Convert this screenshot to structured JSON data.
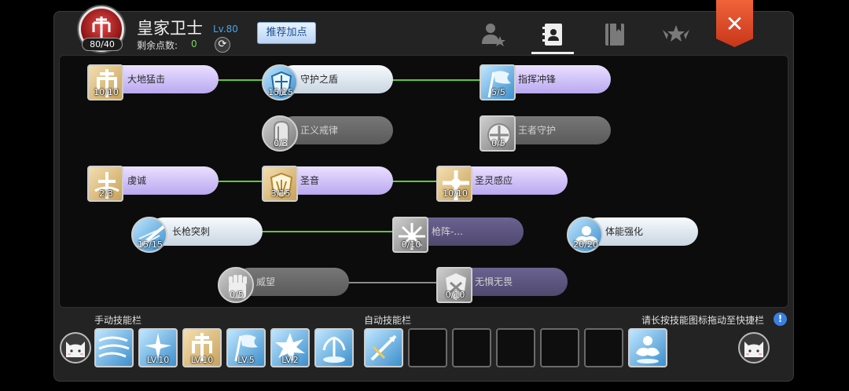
{
  "header": {
    "class_name": "皇家卫士",
    "level": "Lv.80",
    "level_badge": "80/40",
    "points_label": "剩余点数:",
    "points_value": "0",
    "recommend_label": "推荐加点",
    "close_label": "✕"
  },
  "tabs": [
    {
      "name": "character-tab",
      "icon": "person-star-icon",
      "active": false
    },
    {
      "name": "skill-book-tab",
      "icon": "contact-book-icon",
      "active": true
    },
    {
      "name": "book-tab",
      "icon": "book-icon",
      "active": false
    },
    {
      "name": "rank-tab",
      "icon": "winged-star-icon",
      "active": false
    }
  ],
  "skills": [
    {
      "name": "大地猛击",
      "count": "10/10",
      "style": "purple",
      "icon": "gold"
    },
    {
      "name": "守护之盾",
      "count": "15/15",
      "style": "light",
      "icon": "blue"
    },
    {
      "name": "指挥冲锋",
      "count": "5/5",
      "style": "purple",
      "icon": "blue"
    },
    {
      "name": "正义戒律",
      "count": "0/3",
      "style": "gray",
      "icon": "gray"
    },
    {
      "name": "王者守护",
      "count": "0/5",
      "style": "gray",
      "icon": "gray"
    },
    {
      "name": "虔诚",
      "count": "2/3",
      "style": "purple",
      "icon": "gold"
    },
    {
      "name": "圣音",
      "count": "3/15",
      "style": "purple",
      "icon": "gold"
    },
    {
      "name": "圣灵感应",
      "count": "10/10",
      "style": "purple",
      "icon": "gold"
    },
    {
      "name": "长枪突刺",
      "count": "15/15",
      "style": "light",
      "icon": "blue"
    },
    {
      "name": "枪阵-...",
      "count": "0/10",
      "style": "darkpurple",
      "icon": "gray"
    },
    {
      "name": "体能强化",
      "count": "20/20",
      "style": "light",
      "icon": "blue"
    },
    {
      "name": "威望",
      "count": "0/5",
      "style": "gray",
      "icon": "gray"
    },
    {
      "name": "无惧无畏",
      "count": "0/10",
      "style": "darkpurple",
      "icon": "gray"
    }
  ],
  "bars": {
    "manual_label": "手动技能栏",
    "auto_label": "自动技能栏",
    "hint": "请长按技能图标拖动至快捷栏",
    "info_icon": "!",
    "manual_slots": [
      {
        "icon": "wind-blue",
        "level": ""
      },
      {
        "icon": "sparkle-blue",
        "level": "LV.10"
      },
      {
        "icon": "shield-gold",
        "level": "LV.10"
      },
      {
        "icon": "flag-blue",
        "level": "LV.5"
      },
      {
        "icon": "burst-blue",
        "level": "LV.2"
      },
      {
        "icon": "fountain-blue",
        "level": ""
      }
    ],
    "auto_slots": [
      {
        "icon": "spear-blue",
        "level": ""
      },
      {
        "icon": "empty",
        "level": ""
      },
      {
        "icon": "empty",
        "level": ""
      },
      {
        "icon": "empty",
        "level": ""
      },
      {
        "icon": "empty",
        "level": ""
      },
      {
        "icon": "empty",
        "level": ""
      },
      {
        "icon": "muscle-blue",
        "level": ""
      }
    ]
  },
  "colors": {
    "connector_active": "#5fc83a",
    "connector_inactive": "#8a8a8a",
    "accent_blue": "#4aa3e8",
    "close_red": "#e04d2a"
  }
}
